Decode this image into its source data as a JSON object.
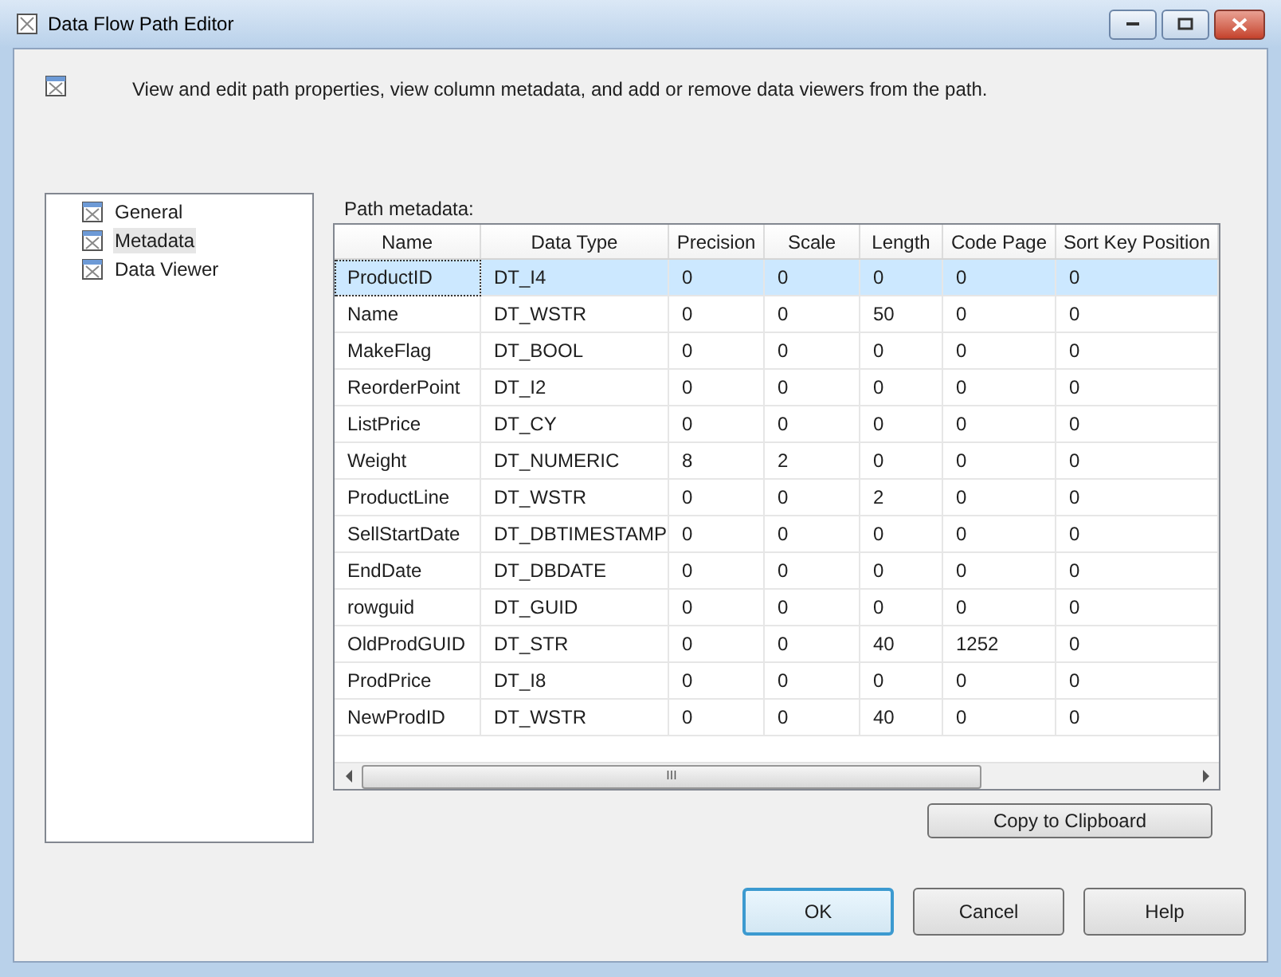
{
  "window": {
    "title": "Data Flow Path Editor"
  },
  "description": "View and edit path properties, view column metadata, and add or remove data viewers from the path.",
  "sidebar": {
    "items": [
      {
        "label": "General",
        "selected": false
      },
      {
        "label": "Metadata",
        "selected": true
      },
      {
        "label": "Data Viewer",
        "selected": false
      }
    ]
  },
  "metadata_label": "Path metadata:",
  "table": {
    "columns": [
      "Name",
      "Data Type",
      "Precision",
      "Scale",
      "Length",
      "Code Page",
      "Sort Key Position"
    ],
    "rows": [
      {
        "cells": [
          "ProductID",
          "DT_I4",
          "0",
          "0",
          "0",
          "0",
          "0"
        ],
        "selected": true
      },
      {
        "cells": [
          "Name",
          "DT_WSTR",
          "0",
          "0",
          "50",
          "0",
          "0"
        ],
        "selected": false
      },
      {
        "cells": [
          "MakeFlag",
          "DT_BOOL",
          "0",
          "0",
          "0",
          "0",
          "0"
        ],
        "selected": false
      },
      {
        "cells": [
          "ReorderPoint",
          "DT_I2",
          "0",
          "0",
          "0",
          "0",
          "0"
        ],
        "selected": false
      },
      {
        "cells": [
          "ListPrice",
          "DT_CY",
          "0",
          "0",
          "0",
          "0",
          "0"
        ],
        "selected": false
      },
      {
        "cells": [
          "Weight",
          "DT_NUMERIC",
          "8",
          "2",
          "0",
          "0",
          "0"
        ],
        "selected": false
      },
      {
        "cells": [
          "ProductLine",
          "DT_WSTR",
          "0",
          "0",
          "2",
          "0",
          "0"
        ],
        "selected": false
      },
      {
        "cells": [
          "SellStartDate",
          "DT_DBTIMESTAMP",
          "0",
          "0",
          "0",
          "0",
          "0"
        ],
        "selected": false
      },
      {
        "cells": [
          "EndDate",
          "DT_DBDATE",
          "0",
          "0",
          "0",
          "0",
          "0"
        ],
        "selected": false
      },
      {
        "cells": [
          "rowguid",
          "DT_GUID",
          "0",
          "0",
          "0",
          "0",
          "0"
        ],
        "selected": false
      },
      {
        "cells": [
          "OldProdGUID",
          "DT_STR",
          "0",
          "0",
          "40",
          "1252",
          "0"
        ],
        "selected": false
      },
      {
        "cells": [
          "ProdPrice",
          "DT_I8",
          "0",
          "0",
          "0",
          "0",
          "0"
        ],
        "selected": false
      },
      {
        "cells": [
          "NewProdID",
          "DT_WSTR",
          "0",
          "0",
          "40",
          "0",
          "0"
        ],
        "selected": false
      }
    ]
  },
  "scroll_glyph": "III",
  "copy_button": "Copy to Clipboard",
  "buttons": [
    {
      "label": "OK",
      "default": true
    },
    {
      "label": "Cancel",
      "default": false
    },
    {
      "label": "Help",
      "default": false
    }
  ]
}
